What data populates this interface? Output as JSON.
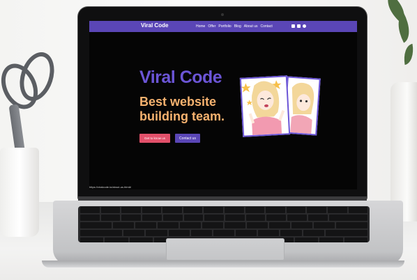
{
  "site": {
    "logo": "Viral Code",
    "nav": [
      "Home",
      "Offer",
      "Portfolio",
      "Blog",
      "About us",
      "Contact"
    ],
    "hero_title": "Viral Code",
    "tagline": "Best website building team.",
    "hire_button": "Get to know us",
    "contact_button": "Contact us",
    "status_url": "https://viralcode.io/about-us.html#"
  },
  "colors": {
    "accent": "#5a46b6",
    "tagline": "#f6b26f",
    "hire": "#e2506a"
  }
}
